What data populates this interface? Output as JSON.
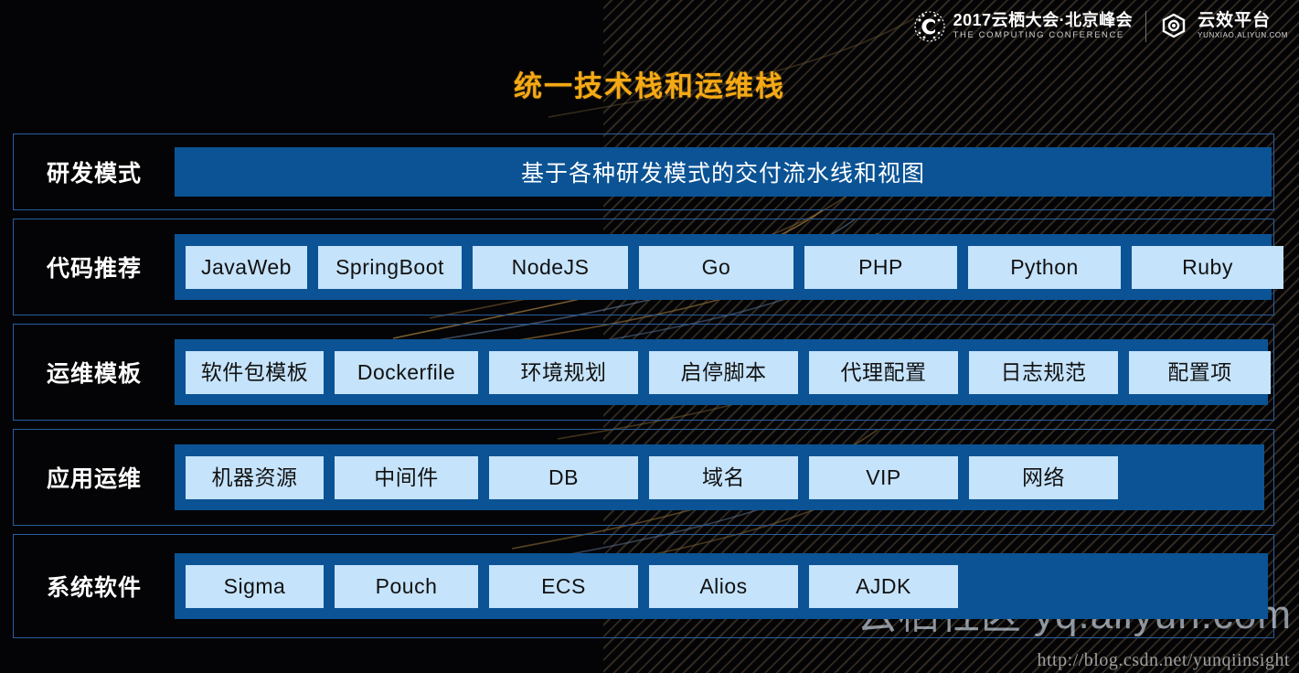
{
  "header": {
    "conference_logo": {
      "icon": "computing-conference-logo-icon",
      "title_cn": "2017云栖大会·北京峰会",
      "title_en": "THE COMPUTING CONFERENCE"
    },
    "product_logo": {
      "icon": "yunxiao-platform-logo-icon",
      "title_cn": "云效平台",
      "title_en": "YUNXIAO.ALIYUN.COM"
    }
  },
  "title": "统一技术栈和运维栈",
  "colors": {
    "background": "#040406",
    "title_gold": "#f5a915",
    "band_blue": "#0b5394",
    "chip_blue": "#c5e3fb",
    "row_border": "#2a5d9e",
    "label_white": "#ffffff"
  },
  "rows": [
    {
      "label": "研发模式",
      "band_text": "基于各种研发模式的交付流水线和视图",
      "chips": []
    },
    {
      "label": "代码推荐",
      "band_text": "",
      "chips": [
        "JavaWeb",
        "SpringBoot",
        "NodeJS",
        "Go",
        "PHP",
        "Python",
        "Ruby"
      ]
    },
    {
      "label": "运维模板",
      "band_text": "",
      "chips": [
        "软件包模板",
        "Dockerfile",
        "环境规划",
        "启停脚本",
        "代理配置",
        "日志规范",
        "配置项"
      ]
    },
    {
      "label": "应用运维",
      "band_text": "",
      "chips": [
        "机器资源",
        "中间件",
        "DB",
        "域名",
        "VIP",
        "网络"
      ]
    },
    {
      "label": "系统软件",
      "band_text": "",
      "chips": [
        "Sigma",
        "Pouch",
        "ECS",
        "Alios",
        "AJDK"
      ]
    }
  ],
  "watermark": {
    "brand": "云栖社区 yq.aliyun.com",
    "url": "http://blog.csdn.net/yunqiinsight"
  }
}
